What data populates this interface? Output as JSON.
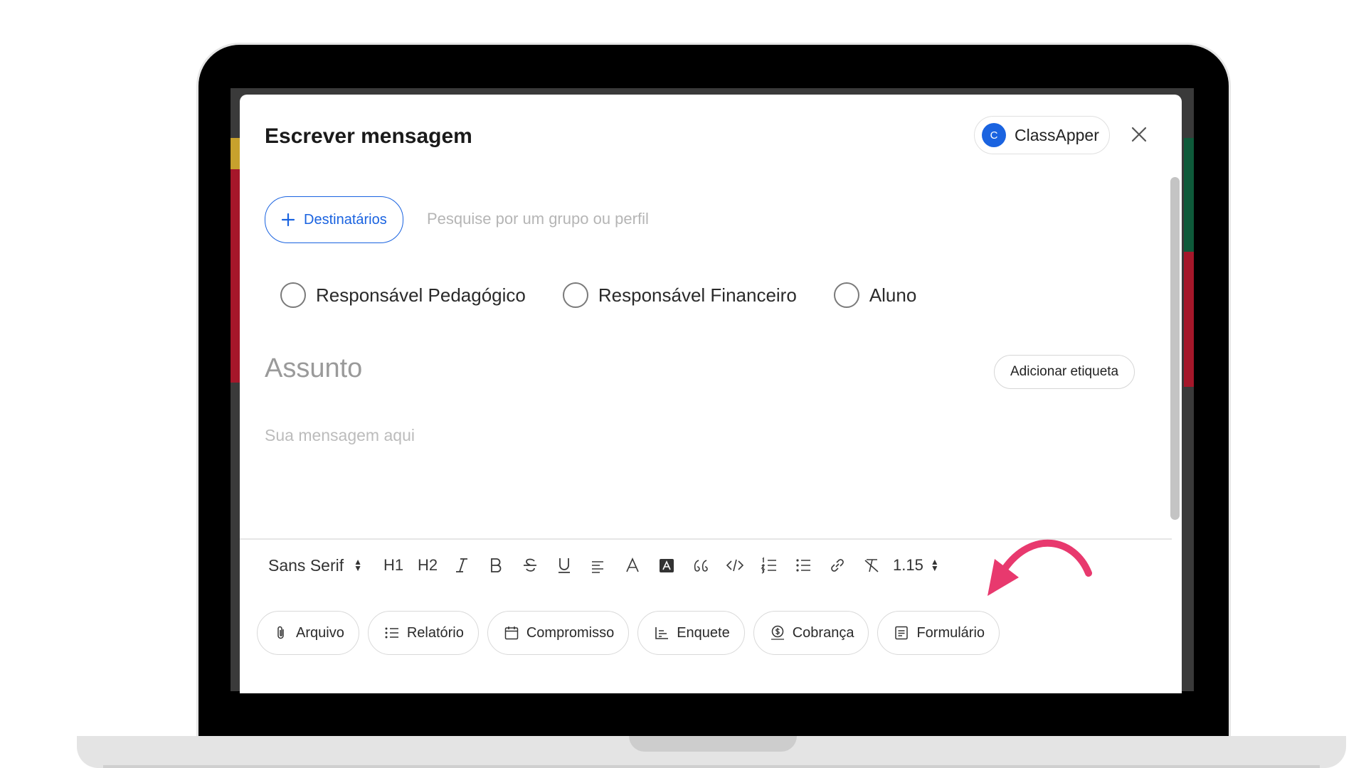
{
  "compose": {
    "title": "Escrever mensagem",
    "account": {
      "initial": "C",
      "name": "ClassApper",
      "avatar_color": "#1a63e0"
    },
    "recipients": {
      "button_label": "Destinatários",
      "search_placeholder": "Pesquise por um grupo ou perfil"
    },
    "roles": [
      {
        "label": "Responsável Pedagógico",
        "checked": false
      },
      {
        "label": "Responsável Financeiro",
        "checked": false
      },
      {
        "label": "Aluno",
        "checked": false
      }
    ],
    "subject_placeholder": "Assunto",
    "tag_button": "Adicionar etiqueta",
    "message_placeholder": "Sua mensagem aqui"
  },
  "toolbar": {
    "font": "Sans Serif",
    "h1": "H1",
    "h2": "H2",
    "line_spacing": "1.15"
  },
  "attachments": [
    {
      "label": "Arquivo",
      "icon": "paperclip-icon"
    },
    {
      "label": "Relatório",
      "icon": "list-icon"
    },
    {
      "label": "Compromisso",
      "icon": "calendar-icon"
    },
    {
      "label": "Enquete",
      "icon": "poll-icon"
    },
    {
      "label": "Cobrança",
      "icon": "money-icon"
    },
    {
      "label": "Formulário",
      "icon": "form-icon"
    }
  ],
  "colors": {
    "accent": "#1a63e0",
    "annotation_arrow": "#e8396e"
  }
}
